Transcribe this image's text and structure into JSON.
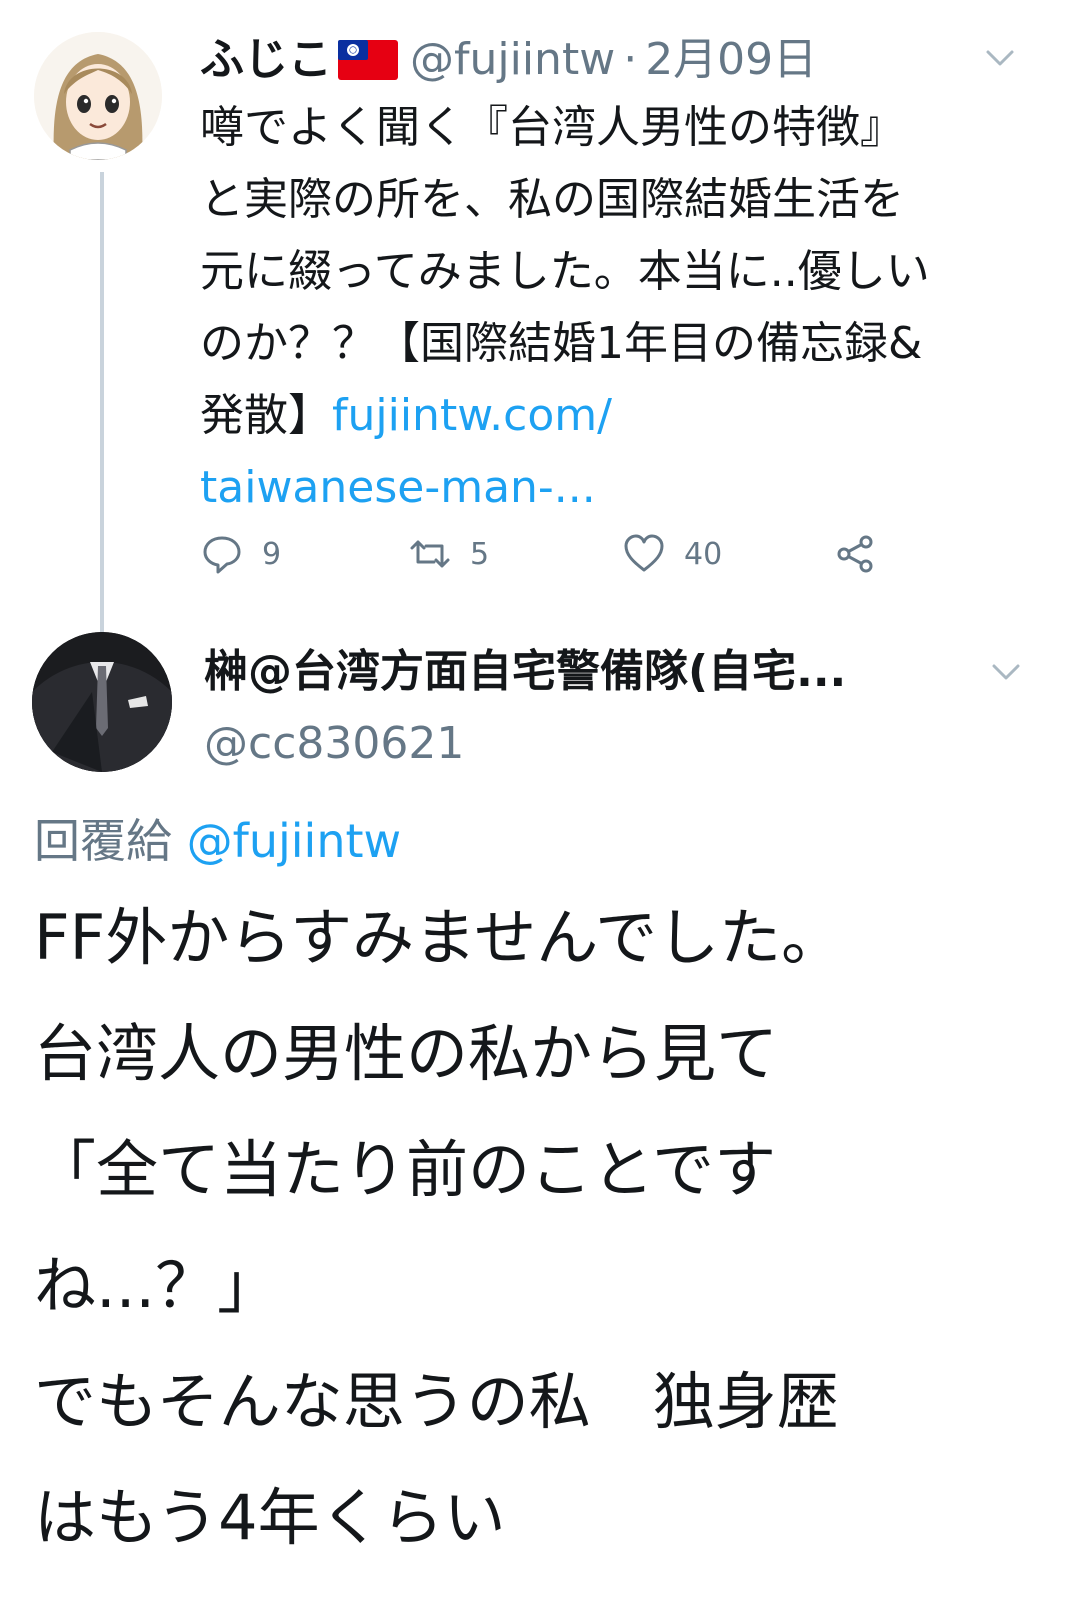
{
  "tweet1": {
    "author_name": "ふじこ",
    "flag_icon": "taiwan-flag-icon",
    "handle": "@fujiintw",
    "separator": "·",
    "date": "2月09日",
    "body_lines": [
      "噂でよく聞く『台湾人男性の特徴』",
      "と実際の所を、私の国際結婚生活を",
      "元に綴ってみました。本当に..優しい",
      "のか？？【国際結婚1年目の備忘録&"
    ],
    "body_line5_text": "発散】",
    "body_line5_link": "fujiintw.com/",
    "body_line6_link": "taiwanese-man-...",
    "actions": {
      "reply_count": "9",
      "retweet_count": "5",
      "like_count": "40"
    }
  },
  "tweet2": {
    "author_name": "榊@台湾方面自宅警備隊(自宅...",
    "handle": "@cc830621",
    "reply_prefix": "回覆給",
    "reply_handle": "@fujiintw",
    "body_lines": [
      "FF外からすみませんでした。",
      "台湾人の男性の私から見て",
      "「全て当たり前のことです",
      "ね...？」",
      "でもそんな思うの私　独身歴",
      "はもう4年くらい"
    ]
  },
  "colors": {
    "text": "#14171a",
    "secondary": "#657786",
    "link": "#1da1f2",
    "thread_line": "#c9d3dc"
  }
}
